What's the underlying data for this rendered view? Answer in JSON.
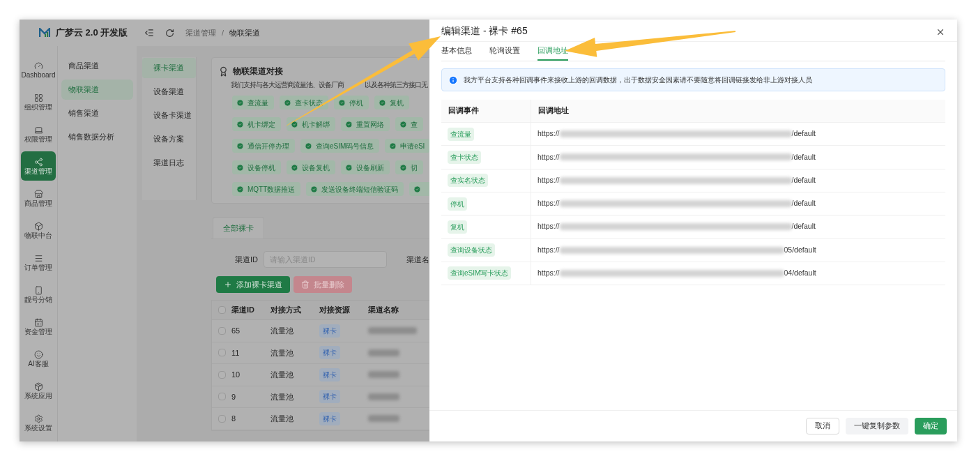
{
  "app": {
    "name": "广梦云 2.0 开发版"
  },
  "nav_rail": [
    {
      "label": "Dashboard",
      "selected": false
    },
    {
      "label": "组织管理",
      "selected": false
    },
    {
      "label": "权限管理",
      "selected": false
    },
    {
      "label": "渠道管理",
      "selected": true
    },
    {
      "label": "商品管理",
      "selected": false
    },
    {
      "label": "物联中台",
      "selected": false
    },
    {
      "label": "订单管理",
      "selected": false
    },
    {
      "label": "靓号分销",
      "selected": false
    },
    {
      "label": "资金管理",
      "selected": false
    },
    {
      "label": "AI客服",
      "selected": false
    },
    {
      "label": "系统应用",
      "selected": false
    },
    {
      "label": "系统设置",
      "selected": false
    }
  ],
  "submenu": [
    {
      "label": "商品渠道",
      "selected": false
    },
    {
      "label": "物联渠道",
      "selected": true
    },
    {
      "label": "销售渠道",
      "selected": false
    },
    {
      "label": "销售数据分析",
      "selected": false
    }
  ],
  "header": {
    "breadcrumb": [
      "渠道管理",
      "物联渠道"
    ],
    "separator": "/"
  },
  "section_menu": [
    {
      "label": "裸卡渠道",
      "selected": true
    },
    {
      "label": "设备渠道",
      "selected": false
    },
    {
      "label": "设备卡渠道",
      "selected": false
    },
    {
      "label": "设备方案",
      "selected": false
    },
    {
      "label": "渠道日志",
      "selected": false
    }
  ],
  "integration_card": {
    "title": "物联渠道对接",
    "description": [
      "我们支持与各大运营商流量池、设备厂商",
      "以及各种第三方接口无"
    ],
    "tag_rows": [
      [
        "查流量",
        "查卡状态",
        "停机",
        "复机"
      ],
      [
        "机卡绑定",
        "机卡解绑",
        "重置网络",
        "查"
      ],
      [
        "通信开停办理",
        "查询eSIM码号信息",
        "申请eSI"
      ],
      [
        "设备停机",
        "设备复机",
        "设备刷新",
        "切"
      ],
      [
        "MQTT数据推送",
        "发送设备终端短信验证码"
      ]
    ]
  },
  "list_tabs": [
    {
      "label": "全部裸卡",
      "selected": true
    }
  ],
  "filters": [
    {
      "label": "渠道ID",
      "placeholder": "请输入渠道ID"
    },
    {
      "label": "渠道名"
    }
  ],
  "actions": [
    {
      "label": "添加裸卡渠道",
      "kind": "primary",
      "disabled": false
    },
    {
      "label": "批量删除",
      "kind": "danger",
      "disabled": true
    }
  ],
  "table": {
    "select_all": {
      "checked": false
    },
    "columns": [
      "渠道ID",
      "对接方式",
      "对接资源",
      "渠道名称"
    ],
    "rows": [
      {
        "id": "65",
        "method": "流量池",
        "resource": "裸卡",
        "checked": false
      },
      {
        "id": "11",
        "method": "流量池",
        "resource": "裸卡",
        "checked": false
      },
      {
        "id": "10",
        "method": "流量池",
        "resource": "裸卡",
        "checked": false
      },
      {
        "id": "9",
        "method": "流量池",
        "resource": "裸卡",
        "checked": false
      },
      {
        "id": "8",
        "method": "流量池",
        "resource": "裸卡",
        "checked": false
      }
    ]
  },
  "drawer": {
    "title": "编辑渠道 - 裸卡 #65",
    "tabs": [
      {
        "label": "基本信息",
        "selected": false
      },
      {
        "label": "轮询设置",
        "selected": false
      },
      {
        "label": "回调地址",
        "selected": true
      }
    ],
    "alert": "我方平台支持各种回调事件来接收上游的回调数据，出于数据安全因素请不要随意将回调链接发给非上游对接人员",
    "table": {
      "columns": [
        "回调事件",
        "回调地址"
      ],
      "rows": [
        {
          "event": "查流量",
          "url_prefix": "https://",
          "url_suffix": "/default"
        },
        {
          "event": "查卡状态",
          "url_prefix": "https://",
          "url_suffix": "/default"
        },
        {
          "event": "查实名状态",
          "url_prefix": "https://",
          "url_suffix": "/default"
        },
        {
          "event": "停机",
          "url_prefix": "https://",
          "url_suffix": "/default"
        },
        {
          "event": "复机",
          "url_prefix": "https://",
          "url_suffix": "/default"
        },
        {
          "event": "查询设备状态",
          "url_prefix": "https://",
          "url_suffix": "05/default"
        },
        {
          "event": "查询eSIM写卡状态",
          "url_prefix": "https://",
          "url_suffix": "04/default"
        }
      ]
    },
    "buttons": [
      {
        "label": "取消",
        "kind": "default"
      },
      {
        "label": "一键复制参数",
        "kind": "secondary"
      },
      {
        "label": "确定",
        "kind": "primary"
      }
    ]
  }
}
